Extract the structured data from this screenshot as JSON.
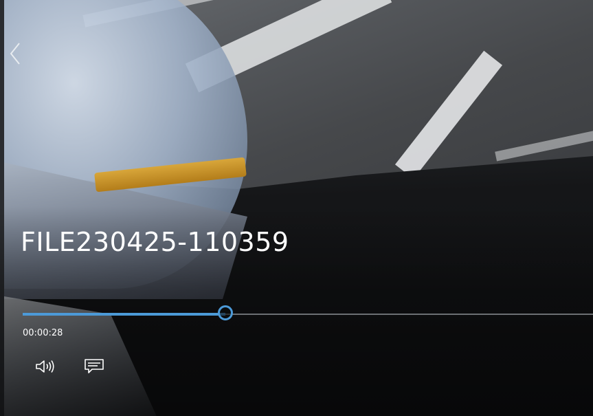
{
  "video": {
    "title": "FILE230425-110359",
    "current_time": "00:00:28",
    "progress_fraction": 0.355
  },
  "controls": {
    "back_icon": "chevron-left-icon",
    "volume_icon": "speaker-icon",
    "captions_icon": "captions-icon"
  },
  "colors": {
    "accent": "#4c9ad8",
    "text": "#ffffff"
  }
}
